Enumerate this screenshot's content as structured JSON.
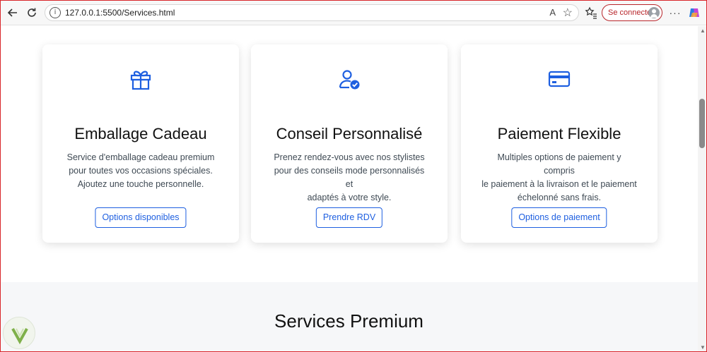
{
  "browser": {
    "url": "127.0.0.1:5500/Services.html",
    "read_aloud_label": "A",
    "signin_label": "Se connecter",
    "icons": [
      "back-icon",
      "reload-icon",
      "info-icon",
      "read-aloud-icon",
      "favorite-star-icon",
      "favorites-icon",
      "more-icon",
      "copilot-icon"
    ]
  },
  "cards": [
    {
      "icon": "gift-icon",
      "title": "Emballage Cadeau",
      "line1": "Service d'emballage cadeau premium",
      "line2": "pour toutes vos occasions spéciales.",
      "line3": "Ajoutez une touche personnelle.",
      "button": "Options disponibles"
    },
    {
      "icon": "user-check-icon",
      "title": "Conseil Personnalisé",
      "line1": "Prenez rendez-vous avec nos stylistes",
      "line2": "pour des conseils mode personnalisés et",
      "line3": "adaptés à votre style.",
      "button": "Prendre RDV"
    },
    {
      "icon": "credit-card-icon",
      "title": "Paiement Flexible",
      "line1": "Multiples options de paiement y compris",
      "line2": "le paiement à la livraison et le paiement",
      "line3": "échelonné sans frais.",
      "button": "Options de paiement"
    }
  ],
  "premium_section": {
    "title": "Services Premium"
  },
  "colors": {
    "accent": "#1e5fe0",
    "frame": "#d9262b",
    "signin": "#b8262b"
  }
}
